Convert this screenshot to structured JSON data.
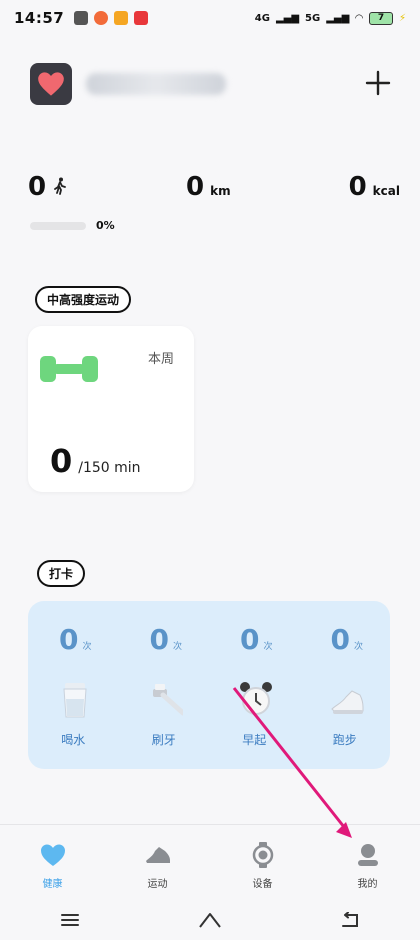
{
  "status_bar": {
    "time": "14:57",
    "network_a": "4G",
    "network_b": "5G",
    "battery": "7"
  },
  "stats": {
    "steps": {
      "value": "0",
      "icon": "walking-icon"
    },
    "distance": {
      "value": "0",
      "unit": "km"
    },
    "calories": {
      "value": "0",
      "unit": "kcal"
    },
    "progress_percent": "0%",
    "progress_fraction": 0
  },
  "activity_section": {
    "title": "中高强度运动",
    "period": "本周",
    "value": "0",
    "goal": "/150 min",
    "icon": "dumbbell-icon",
    "accent": "#6ed67e"
  },
  "checkin_section": {
    "title": "打卡",
    "items": [
      {
        "count": "0",
        "unit": "次",
        "label": "喝水",
        "icon": "water-cup-icon"
      },
      {
        "count": "0",
        "unit": "次",
        "label": "刷牙",
        "icon": "toothbrush-icon"
      },
      {
        "count": "0",
        "unit": "次",
        "label": "早起",
        "icon": "alarm-clock-icon"
      },
      {
        "count": "0",
        "unit": "次",
        "label": "跑步",
        "icon": "running-shoe-icon"
      }
    ]
  },
  "bottom_nav": [
    {
      "label": "健康",
      "icon": "heart-icon",
      "active": true
    },
    {
      "label": "运动",
      "icon": "sneaker-icon",
      "active": false
    },
    {
      "label": "设备",
      "icon": "watch-icon",
      "active": false
    },
    {
      "label": "我的",
      "icon": "person-icon",
      "active": false
    }
  ],
  "colors": {
    "accent_blue": "#3ba0e8",
    "checkin_bg": "#dcedfb",
    "annotation_arrow": "#e0197a",
    "logo_heart": "#f0686f"
  }
}
